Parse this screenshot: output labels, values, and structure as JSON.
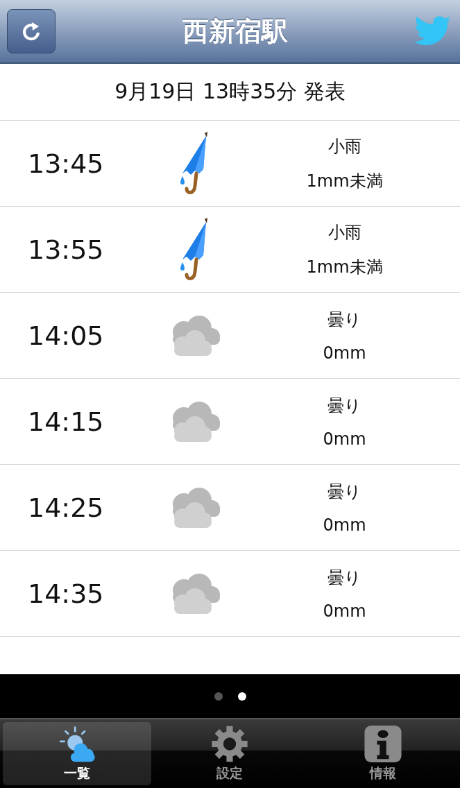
{
  "header": {
    "title": "西新宿駅"
  },
  "announcement": "9月19日 13時35分 発表",
  "forecast": [
    {
      "time": "13:45",
      "kind": "rain",
      "condition": "小雨",
      "amount": "1mm未満"
    },
    {
      "time": "13:55",
      "kind": "rain",
      "condition": "小雨",
      "amount": "1mm未満"
    },
    {
      "time": "14:05",
      "kind": "cloudy",
      "condition": "曇り",
      "amount": "0mm"
    },
    {
      "time": "14:15",
      "kind": "cloudy",
      "condition": "曇り",
      "amount": "0mm"
    },
    {
      "time": "14:25",
      "kind": "cloudy",
      "condition": "曇り",
      "amount": "0mm"
    },
    {
      "time": "14:35",
      "kind": "cloudy",
      "condition": "曇り",
      "amount": "0mm"
    }
  ],
  "page_dots": [
    {
      "selected": false
    },
    {
      "selected": true
    }
  ],
  "tabs": [
    {
      "label": "一覧",
      "kind": "weather",
      "selected": true
    },
    {
      "label": "設定",
      "kind": "settings",
      "selected": false
    },
    {
      "label": "情報",
      "kind": "info",
      "selected": false
    }
  ]
}
